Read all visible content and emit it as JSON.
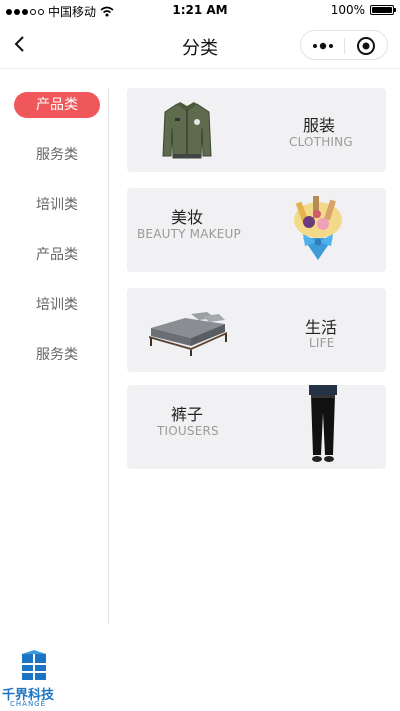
{
  "status_bar": {
    "carrier": "中国移动",
    "time": "1:21 AM",
    "battery": "100%",
    "battery_level": 1.0
  },
  "navbar": {
    "title": "分类"
  },
  "sidebar": {
    "items": [
      {
        "label": "产品类",
        "active": true
      },
      {
        "label": "服务类",
        "active": false
      },
      {
        "label": "培训类",
        "active": false
      },
      {
        "label": "产品类",
        "active": false
      },
      {
        "label": "培训类",
        "active": false
      },
      {
        "label": "服务类",
        "active": false
      }
    ]
  },
  "categories": [
    {
      "title": "服装",
      "subtitle": "CLOTHING",
      "image": "jacket-image"
    },
    {
      "title": "美妆",
      "subtitle": "BEAUTY MAKEUP",
      "image": "makeup-bouquet-image"
    },
    {
      "title": "生活",
      "subtitle": "LIFE",
      "image": "bed-image"
    },
    {
      "title": "裤子",
      "subtitle": "TIOUSERS",
      "image": "trousers-image"
    }
  ],
  "logo": {
    "name": "千界科技",
    "tagline": "CHANGE",
    "color": "#1c74c4"
  },
  "colors": {
    "accent": "#f0575a",
    "card_bg": "#f1f1f3"
  }
}
